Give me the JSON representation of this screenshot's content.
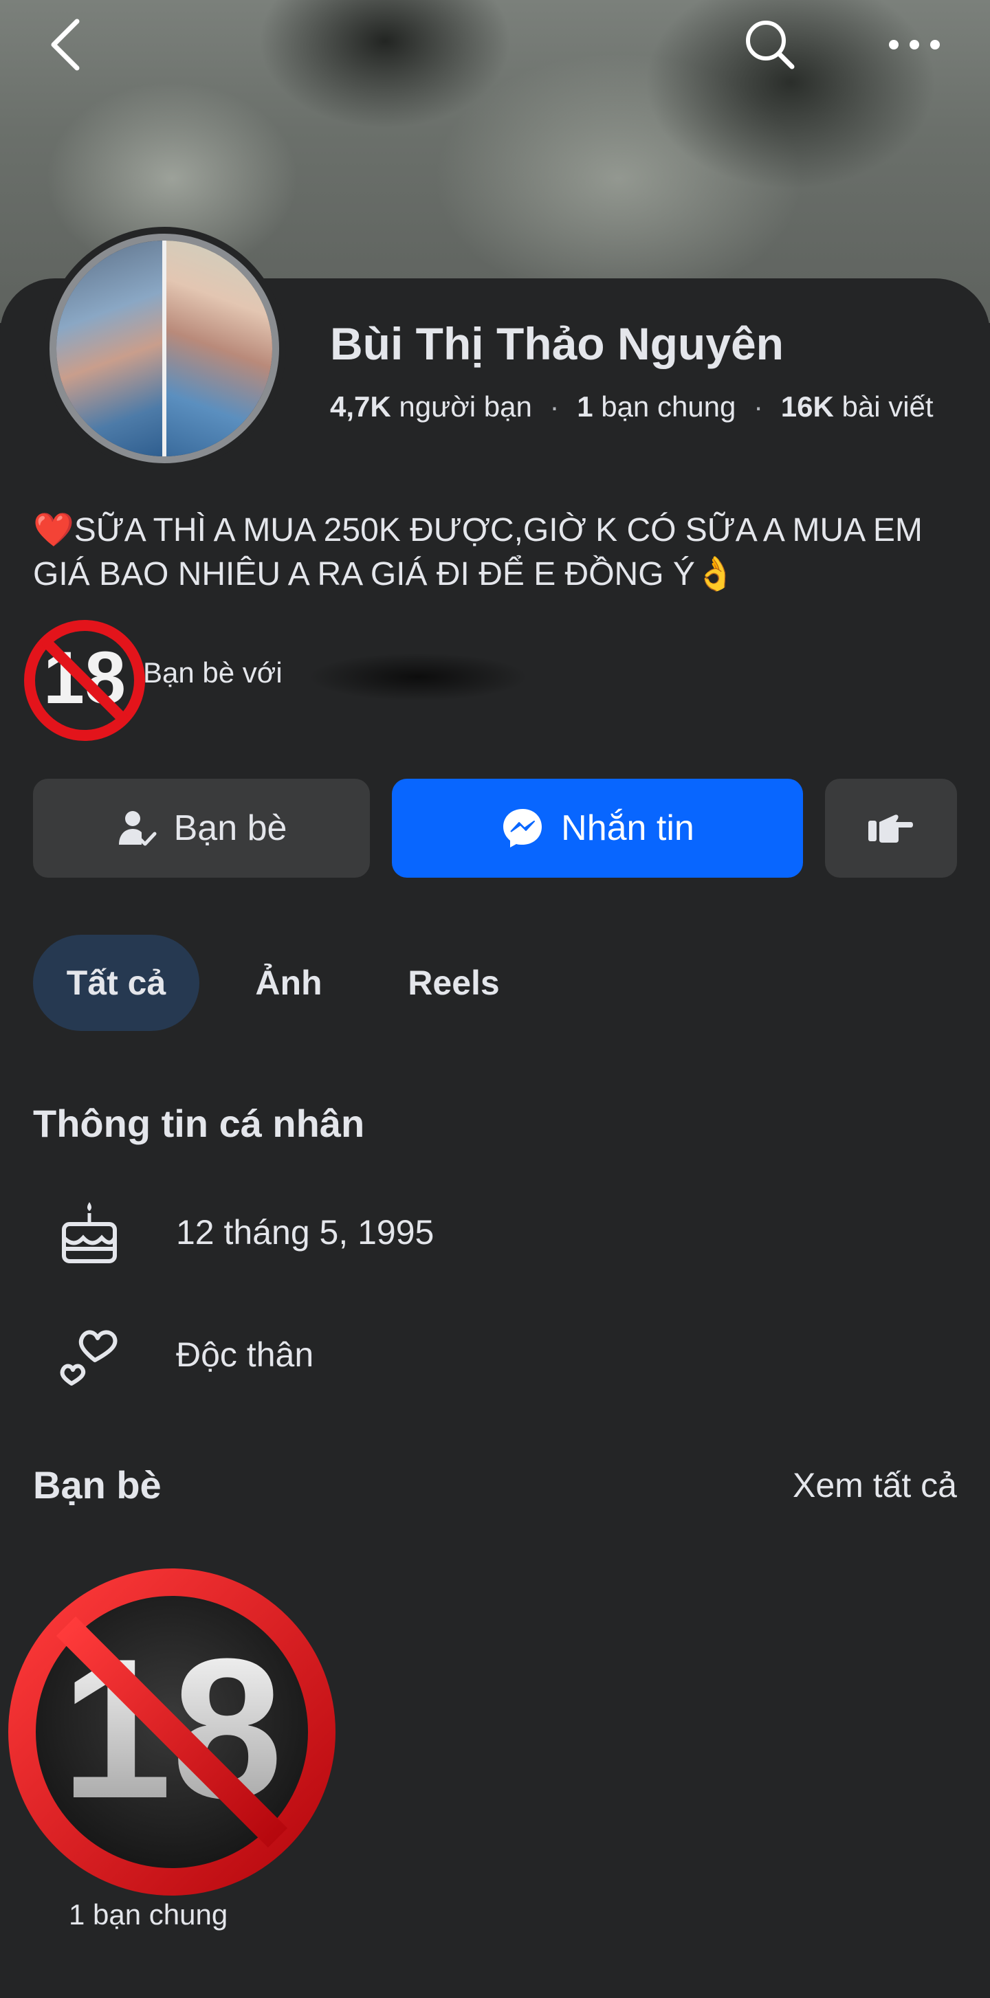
{
  "header": {
    "back_icon": "chevron-left-icon",
    "search_icon": "search-icon",
    "more_icon": "more-horizontal-icon"
  },
  "profile": {
    "name": "Bùi Thị Thảo Nguyên",
    "friends_count": "4,7K",
    "friends_label": "người bạn",
    "mutual_count": "1",
    "mutual_label": "bạn chung",
    "posts_count": "16K",
    "posts_label": "bài viết",
    "bio": "❤️SỮA THÌ A MUA 250K ĐƯỢC,GIỜ K CÓ SỮA A MUA EM GIÁ BAO NHIÊU A RA GIÁ ĐI ĐỂ E ĐỒNG Ý👌",
    "mutual_friends_text": "Bạn bè với",
    "censor_badge_text": "18"
  },
  "actions": {
    "friends_label": "Bạn bè",
    "message_label": "Nhắn tin",
    "colors": {
      "primary": "#0866ff",
      "secondary": "#3a3b3c"
    }
  },
  "tabs": [
    {
      "label": "Tất cả",
      "active": true
    },
    {
      "label": "Ảnh",
      "active": false
    },
    {
      "label": "Reels",
      "active": false
    }
  ],
  "personal_info": {
    "title": "Thông tin cá nhân",
    "items": [
      {
        "icon": "birthday-cake-icon",
        "text": "12 tháng 5, 1995"
      },
      {
        "icon": "hearts-icon",
        "text": "Độc thân"
      }
    ]
  },
  "friends_section": {
    "title": "Bạn bè",
    "see_all": "Xem tất cả",
    "card_caption": "1 bạn chung",
    "card_badge_text": "18"
  }
}
